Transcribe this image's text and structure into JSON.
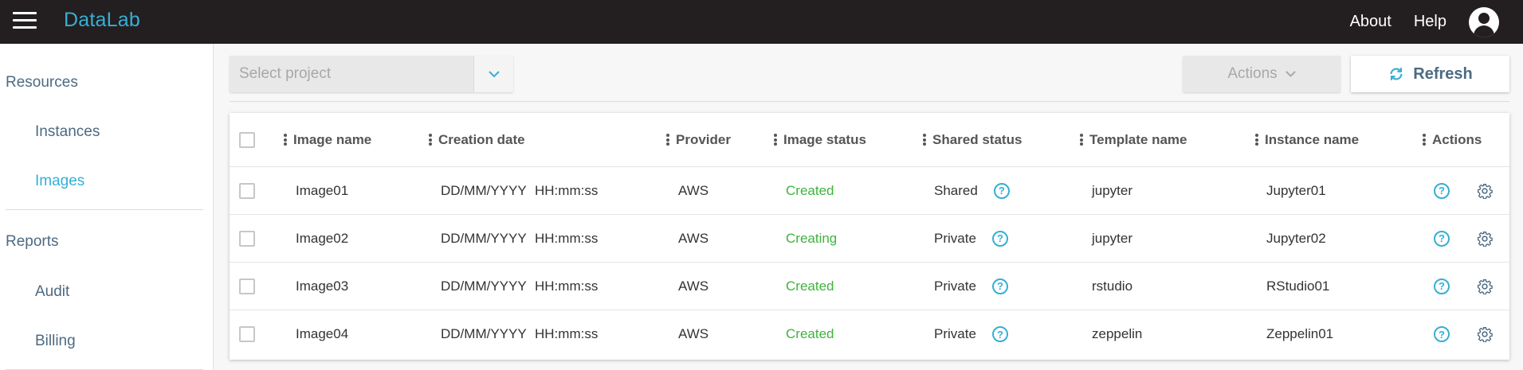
{
  "header": {
    "logo": "DataLab",
    "links": [
      "About",
      "Help"
    ]
  },
  "sidebar": {
    "sections": [
      {
        "label": "Resources",
        "items": [
          "Instances",
          "Images"
        ]
      },
      {
        "label": "Reports",
        "items": [
          "Audit",
          "Billing"
        ]
      }
    ],
    "active_item": "Images"
  },
  "toolbar": {
    "select_placeholder": "Select project",
    "actions_label": "Actions",
    "refresh_label": "Refresh"
  },
  "table": {
    "columns": [
      "Image name",
      "Creation date",
      "Provider",
      "Image status",
      "Shared status",
      "Template name",
      "Instance name",
      "Actions"
    ],
    "rows": [
      {
        "name": "Image01",
        "date": "DD/MM/YYYY",
        "time": "HH:mm:ss",
        "provider": "AWS",
        "status": "Created",
        "shared": "Shared",
        "template": "jupyter",
        "instance": "Jupyter01"
      },
      {
        "name": "Image02",
        "date": "DD/MM/YYYY",
        "time": "HH:mm:ss",
        "provider": "AWS",
        "status": "Creating",
        "shared": "Private",
        "template": "jupyter",
        "instance": "Jupyter02"
      },
      {
        "name": "Image03",
        "date": "DD/MM/YYYY",
        "time": "HH:mm:ss",
        "provider": "AWS",
        "status": "Created",
        "shared": "Private",
        "template": "rstudio",
        "instance": "RStudio01"
      },
      {
        "name": "Image04",
        "date": "DD/MM/YYYY",
        "time": "HH:mm:ss",
        "provider": "AWS",
        "status": "Created",
        "shared": "Private",
        "template": "zeppelin",
        "instance": "Zeppelin01"
      }
    ]
  },
  "icons": {
    "menu": "hamburger-menu-icon",
    "user": "user-avatar-icon",
    "dropdown": "chevron-down-icon",
    "refresh": "refresh-icon",
    "help": "question-circle-icon",
    "settings": "gear-icon"
  },
  "colors": {
    "topbar": "#231f20",
    "accent": "#36afd5",
    "status_green": "#3eb33e",
    "nav_text": "#4d6a82"
  }
}
